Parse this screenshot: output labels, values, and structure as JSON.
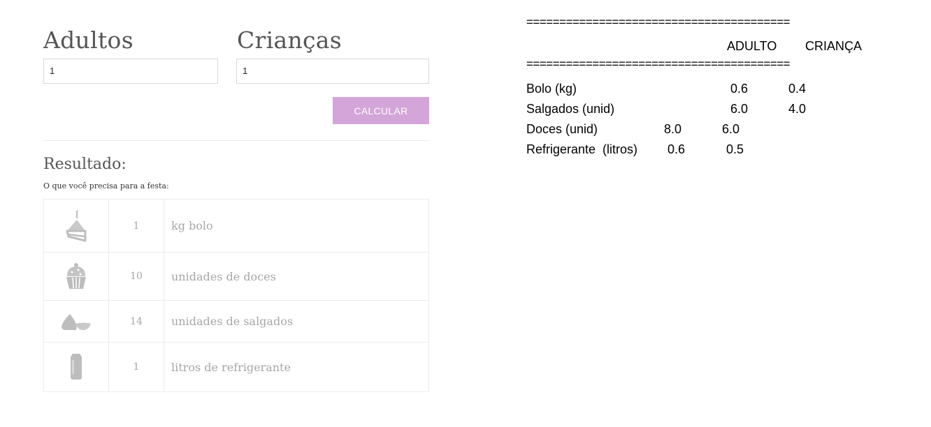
{
  "form": {
    "adultos_label": "Adultos",
    "adultos_value": "1",
    "criancas_label": "Crianças",
    "criancas_value": "1",
    "button_label": "CALCULAR"
  },
  "result": {
    "title": "Resultado:",
    "subtitle": "O que você precisa para a festa:",
    "items": [
      {
        "icon": "cake-slice-icon",
        "qty": "1",
        "desc": "kg bolo"
      },
      {
        "icon": "cupcake-icon",
        "qty": "10",
        "desc": "unidades de doces"
      },
      {
        "icon": "snack-icon",
        "qty": "14",
        "desc": "unidades de salgados"
      },
      {
        "icon": "soda-can-icon",
        "qty": "1",
        "desc": "litros de refrigerante"
      }
    ]
  },
  "console": {
    "separator": "========================================",
    "header_adulto": "ADULTO",
    "header_crianca": "CRIANÇA",
    "rows": [
      {
        "label": "Bolo (kg)",
        "adulto": "0.6",
        "crianca": "0.4"
      },
      {
        "label": "Salgados (unid)",
        "adulto": "6.0",
        "crianca": "4.0"
      },
      {
        "label": "Doces (unid)",
        "adulto": "8.0",
        "crianca": "6.0"
      },
      {
        "label": "Refrigerante  (litros)",
        "adulto": "0.6",
        "crianca": "0.5"
      }
    ]
  },
  "colors": {
    "button_bg": "#d4a5d9",
    "icon_gray": "#a7a7a7",
    "border": "#ececec"
  }
}
